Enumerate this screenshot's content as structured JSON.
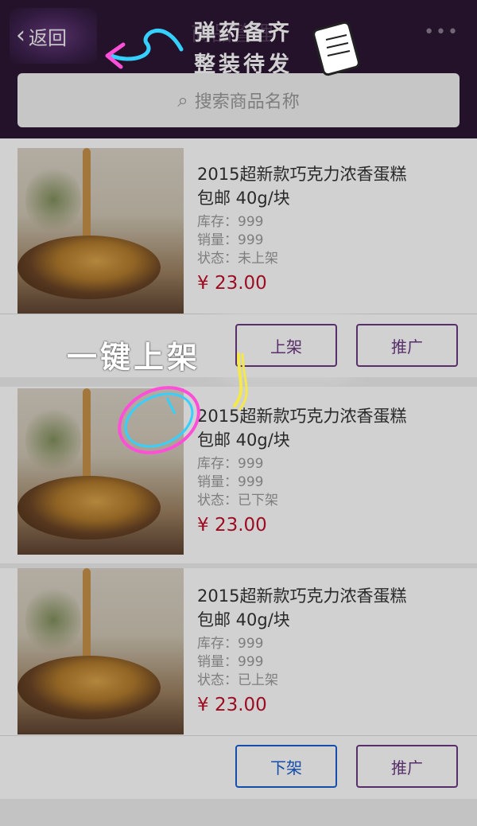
{
  "header": {
    "back_label": "返回",
    "title": "商品管理",
    "more": "•••",
    "slogan_line1": "弹药备齐",
    "slogan_line2": "整装待发"
  },
  "search": {
    "placeholder": "搜索商品名称"
  },
  "products": [
    {
      "name": "2015超新款巧克力浓香蛋糕",
      "spec": "包邮  40g/块",
      "stock": "库存：999",
      "sales": "销量：999",
      "status": "状态：未上架",
      "price": "¥ 23.00",
      "buttons": [
        "上架",
        "推广"
      ]
    },
    {
      "name": "2015超新款巧克力浓香蛋糕",
      "spec": "包邮  40g/块",
      "stock": "库存：999",
      "sales": "销量：999",
      "status": "状态：已下架",
      "price": "¥ 23.00"
    },
    {
      "name": "2015超新款巧克力浓香蛋糕",
      "spec": "包邮  40g/块",
      "stock": "库存：999",
      "sales": "销量：999",
      "status": "状态：已上架",
      "price": "¥ 23.00",
      "buttons": [
        "下架",
        "推广"
      ]
    }
  ],
  "callout": "一键上架",
  "colors": {
    "header_bg": "#2b1734",
    "price": "#c0102a",
    "purple_btn": "#6b3a82",
    "blue_btn": "#1a5fd0"
  },
  "icons": [
    "chevron-left-icon",
    "search-icon",
    "more-icon",
    "arrow-doodle-icon",
    "mouse-doodle-icon",
    "scroll-doodle-icon"
  ]
}
